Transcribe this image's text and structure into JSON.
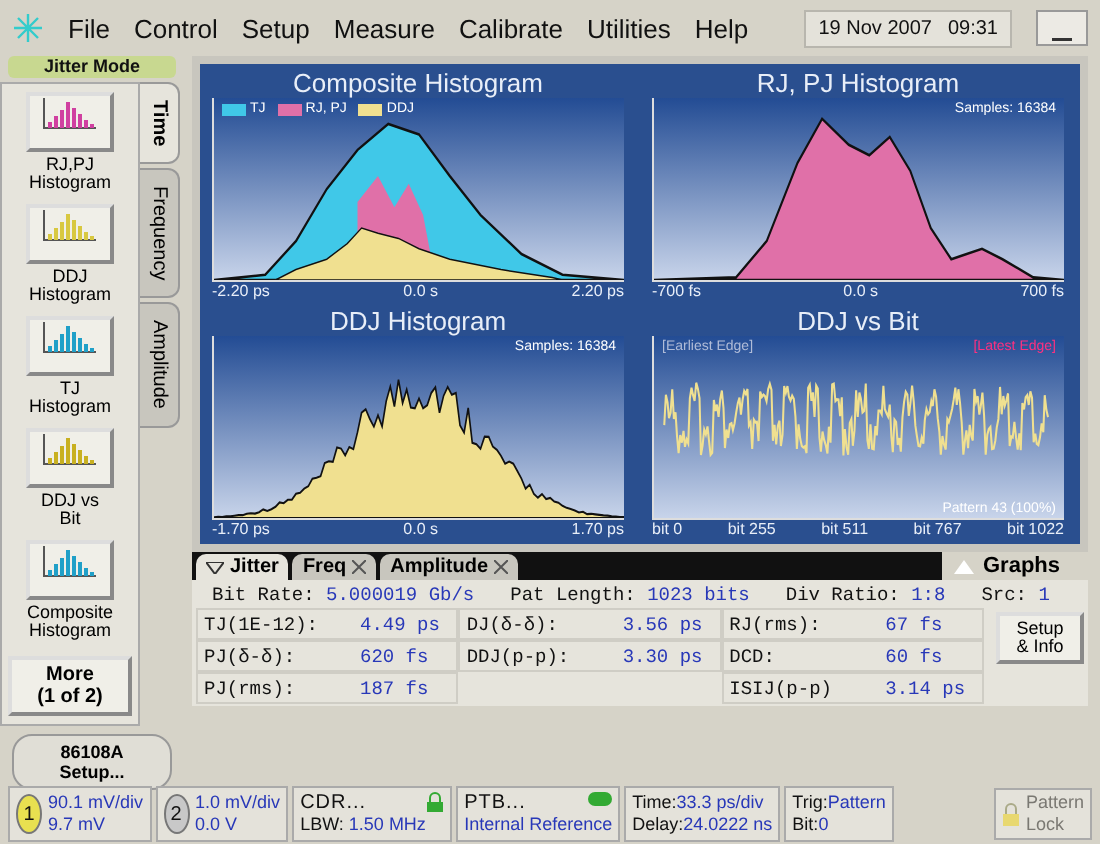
{
  "menu": {
    "items": [
      "File",
      "Control",
      "Setup",
      "Measure",
      "Calibrate",
      "Utilities",
      "Help"
    ],
    "date": "19 Nov 2007",
    "time": "09:31"
  },
  "mode_label": "Jitter Mode",
  "plot_buttons": [
    {
      "lines": [
        "RJ,PJ",
        "Histogram"
      ],
      "color": "#d040a0"
    },
    {
      "lines": [
        "DDJ",
        "Histogram"
      ],
      "color": "#d8c840"
    },
    {
      "lines": [
        "TJ",
        "Histogram"
      ],
      "color": "#20a0c8"
    },
    {
      "lines": [
        "DDJ vs",
        "Bit"
      ],
      "color": "#c8b020"
    },
    {
      "lines": [
        "Composite",
        "Histogram"
      ],
      "color": "#20a0c8"
    }
  ],
  "side_tabs": [
    {
      "label": "Time",
      "selected": true
    },
    {
      "label": "Frequency",
      "selected": false
    },
    {
      "label": "Amplitude",
      "selected": false
    }
  ],
  "more_button": [
    "More",
    "(1 of 2)"
  ],
  "setup_button": [
    "86108A",
    "Setup..."
  ],
  "graphs": [
    {
      "kind": "composite",
      "title": "Composite Histogram",
      "legend": [
        {
          "label": "TJ",
          "color": "#40c8e8"
        },
        {
          "label": "RJ, PJ",
          "color": "#e070a8"
        },
        {
          "label": "DDJ",
          "color": "#f0e090"
        }
      ],
      "x_labels": [
        "-2.20 ps",
        "0.0 s",
        "2.20 ps"
      ]
    },
    {
      "kind": "rjpj",
      "title": "RJ, PJ Histogram",
      "samples": "Samples: 16384",
      "x_labels": [
        "-700 fs",
        "0.0 s",
        "700 fs"
      ]
    },
    {
      "kind": "ddj",
      "title": "DDJ Histogram",
      "samples": "Samples: 16384",
      "x_labels": [
        "-1.70 ps",
        "0.0 s",
        "1.70 ps"
      ]
    },
    {
      "kind": "ddjbit",
      "title": "DDJ vs Bit",
      "left_note": "[Earliest Edge]",
      "right_note": "[Latest Edge]",
      "footer": "Pattern 43 (100%)",
      "x_labels": [
        "bit 0",
        "bit 255",
        "bit 511",
        "bit 767",
        "bit 1022"
      ]
    }
  ],
  "bottom_tabs": [
    {
      "label": "Jitter",
      "selected": true,
      "closable": false
    },
    {
      "label": "Freq",
      "selected": false,
      "closable": true
    },
    {
      "label": "Amplitude",
      "selected": false,
      "closable": true
    }
  ],
  "graphs_toggle": "Graphs",
  "summary": [
    {
      "label": "Bit Rate:",
      "value": "5.000019 Gb/s"
    },
    {
      "label": "Pat Length:",
      "value": "1023 bits"
    },
    {
      "label": "Div Ratio:",
      "value": "1:8"
    },
    {
      "label": "Src:",
      "value": "1"
    }
  ],
  "measurement_columns": [
    [
      {
        "label": "TJ(1E-12):",
        "value": "4.49 ps"
      },
      {
        "label": "PJ(δ-δ):",
        "value": "620 fs"
      },
      {
        "label": "PJ(rms):",
        "value": "187 fs"
      }
    ],
    [
      {
        "label": "DJ(δ-δ):",
        "value": "3.56 ps"
      },
      {
        "label": "DDJ(p-p):",
        "value": "3.30 ps"
      }
    ],
    [
      {
        "label": "RJ(rms):",
        "value": "67 fs"
      },
      {
        "label": "DCD:",
        "value": "60 fs"
      },
      {
        "label": "ISIJ(p-p)",
        "value": "3.14 ps"
      }
    ]
  ],
  "setup_info_button": [
    "Setup",
    "& Info"
  ],
  "status": [
    {
      "kind": "channel",
      "number": "1",
      "color": "#e8e050",
      "lines": [
        "90.1 mV/div",
        "9.7 mV"
      ]
    },
    {
      "kind": "channel",
      "number": "2",
      "color": "#c8c8c8",
      "lines": [
        "1.0 mV/div",
        "0.0 V"
      ]
    },
    {
      "kind": "cdr",
      "title": "CDR...",
      "label": "LBW:",
      "value": "1.50 MHz"
    },
    {
      "kind": "ptb",
      "title": "PTB...",
      "value": "Internal Reference"
    },
    {
      "kind": "pairs",
      "pairs": [
        {
          "label": "Time:",
          "value": "33.3 ps/div"
        },
        {
          "label": "Delay:",
          "value": "24.0222 ns"
        }
      ]
    },
    {
      "kind": "pairs",
      "pairs": [
        {
          "label": "Trig:",
          "value": "Pattern"
        },
        {
          "label": "Bit:",
          "value": "0"
        }
      ]
    }
  ],
  "pattern_lock": {
    "lines": [
      "Pattern",
      "Lock"
    ],
    "disabled": true
  }
}
